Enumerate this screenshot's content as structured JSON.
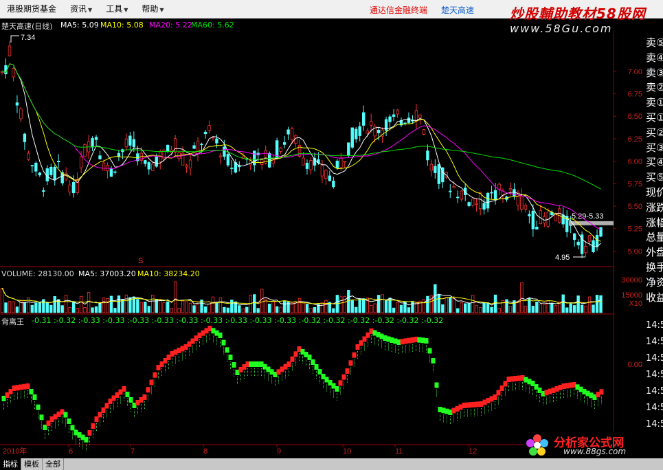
{
  "menu": [
    {
      "label": "港股期货基金",
      "caret": ""
    },
    {
      "label": "资讯",
      "caret": "▼"
    },
    {
      "label": "工具",
      "caret": "▼"
    },
    {
      "label": "帮助",
      "caret": "▼"
    }
  ],
  "promo_text": "通达信金融终端",
  "stock_link": "楚天高速",
  "watermark_top": "炒股輔助教材58股网",
  "watermark_url": "www.58Gu.com",
  "price_header": {
    "name": "楚天高速(日线)",
    "ma5": "MA5: 5.09",
    "ma10": "MA10: 5.08",
    "ma20": "MA20: 5.22",
    "ma60": "MA60: 5.62"
  },
  "volume_header": {
    "vol": "VOLUME: 28130.00",
    "ma5": "MA5: 37003.20",
    "ma10": "MA10: 38234.20"
  },
  "indicator_header": {
    "name": "背离王",
    "values": [
      "-0.31",
      "-0.32",
      "-0.33",
      "-0.33",
      "-0.33",
      "-0.33",
      "-0.33",
      "-0.33",
      "-0.33",
      "-0.33",
      "-0.33",
      "-0.32",
      "-0.32",
      "-0.32",
      "-0.32",
      "-0.32",
      "-0.32"
    ]
  },
  "price_axis_labels": [
    "7.00",
    "6.75",
    "6.50",
    "6.25",
    "6.00",
    "5.75",
    "5.50",
    "5.25",
    "5.00"
  ],
  "volume_axis_labels": [
    "30000",
    "15000",
    "X10"
  ],
  "indicator_axis_labels": [
    "0.00"
  ],
  "annotations": {
    "high": "7.34",
    "low": "4.95",
    "range": "5.29-5.33",
    "s_marker": "S"
  },
  "x_axis_labels": [
    "2010年",
    "6",
    "7",
    "8",
    "9",
    "10",
    "11",
    "12"
  ],
  "right_panel_labels": [
    "卖⑤",
    "卖④",
    "卖③",
    "卖②",
    "卖①",
    "买①",
    "买②",
    "买③",
    "买④",
    "买⑤",
    "现价",
    "涨跌",
    "涨幅",
    "总量",
    "外盘",
    "换手",
    "净资",
    "收益"
  ],
  "right_panel_times": [
    "14:5",
    "14:5",
    "14:5",
    "14:5",
    "14:5",
    "14:5",
    "14:5"
  ],
  "tabs": [
    "指标",
    "模板",
    "全部"
  ],
  "logo": {
    "name": "分析家公式网",
    "url": "www.88gs.com"
  },
  "colors": {
    "up": "#ff3232",
    "down": "#54fcfc",
    "ma5": "#ffffff",
    "ma10": "#ffff00",
    "ma20": "#ff00ff",
    "ma60": "#00e000",
    "axis": "#a00000",
    "indicator_up": "#ff2020",
    "indicator_down": "#20ff20",
    "promo": "#e00000",
    "link": "#1060d0"
  }
}
